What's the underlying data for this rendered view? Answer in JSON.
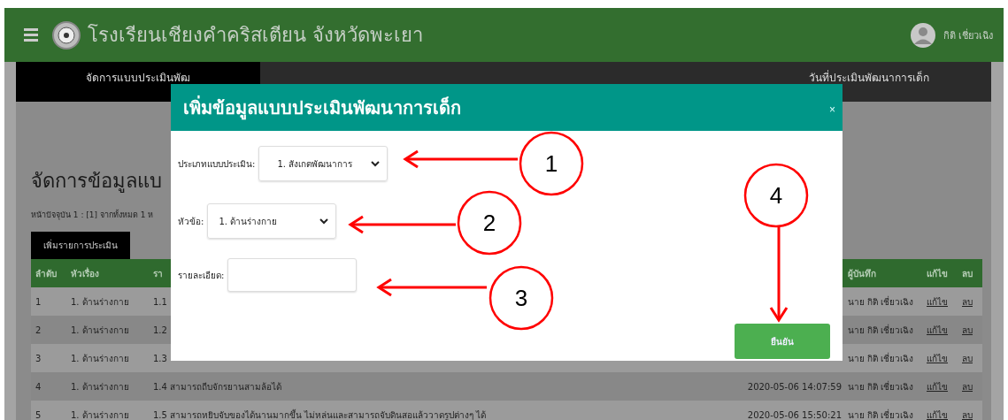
{
  "header": {
    "title": "โรงเรียนเชียงคำคริสเตียน จังหวัดพะเยา",
    "user": "กิติ เชี่ยวเฉิง"
  },
  "tabs": [
    {
      "label": "จัดการแบบประเมินพัฒ",
      "selected": true
    },
    {
      "selected": false
    },
    {
      "selected": false
    },
    {
      "label": "วันที่ประเมินพัฒนาการเด็ก",
      "selected": false
    }
  ],
  "page": {
    "heading": "จัดการข้อมูลแบ",
    "pager": "หน้าปัจจุบัน 1 : [1] จากทั้งหมด 1 ห",
    "add_button": "เพิ่มรายการประเมิน"
  },
  "table": {
    "columns": [
      {
        "label": "ลำดับ"
      },
      {
        "label": "หัวเรื่อง"
      },
      {
        "label": "รา"
      },
      {},
      {
        "label": "ผู้บันทึก"
      },
      {
        "label": "แก้ไข"
      },
      {
        "label": "ลบ"
      }
    ],
    "rows": [
      {
        "no": "1",
        "topic": "1. ด้านร่างกาย",
        "detail": "1.1",
        "recorder": "นาย กิติ เชี่ยวเฉิง",
        "edit": "แก้ไข",
        "delete": "ลบ"
      },
      {
        "no": "2",
        "topic": "1. ด้านร่างกาย",
        "detail": "1.2",
        "recorder": "นาย กิติ เชี่ยวเฉิง",
        "edit": "แก้ไข",
        "delete": "ลบ"
      },
      {
        "no": "3",
        "topic": "1. ด้านร่างกาย",
        "detail": "1.3",
        "recorder": "นาย กิติ เชี่ยวเฉิง",
        "edit": "แก้ไข",
        "delete": "ลบ"
      },
      {
        "no": "4",
        "topic": "1. ด้านร่างกาย",
        "detail": "1.4 สามารถถีบจักรยานสามล้อได้",
        "date": "2020-05-06 14:07:59",
        "recorder": "นาย กิติ เชี่ยวเฉิง",
        "edit": "แก้ไข",
        "delete": "ลบ"
      },
      {
        "no": "5",
        "topic": "1. ด้านร่างกาย",
        "detail": "1.5 สามารถหยิบจับของได้นานมากขึ้น ไม่หล่นและสามารถจับดินสอแล้ววาดรูปต่างๆ ได้",
        "date": "2020-05-06 15:50:21",
        "recorder": "นาย กิติ เชี่ยวเฉิง",
        "edit": "แก้ไข",
        "delete": "ลบ"
      }
    ]
  },
  "modal": {
    "title": "เพิ่มข้อมูลแบบประเมินพัฒนาการเด็ก",
    "close": "×",
    "fields": [
      {
        "kind": "select",
        "label": "ประเภทแบบประเมิน:",
        "value": "1. สังเกตพัฒนาการ"
      },
      {
        "kind": "select",
        "label": "หัวข้อ:",
        "value": "1. ด้านร่างกาย"
      },
      {
        "kind": "text",
        "label": "รายละเอียด:"
      }
    ],
    "confirm": "ยืนยัน"
  },
  "annotations": [
    {
      "label": "1"
    },
    {
      "label": "2"
    },
    {
      "label": "3"
    },
    {
      "label": "4"
    }
  ]
}
